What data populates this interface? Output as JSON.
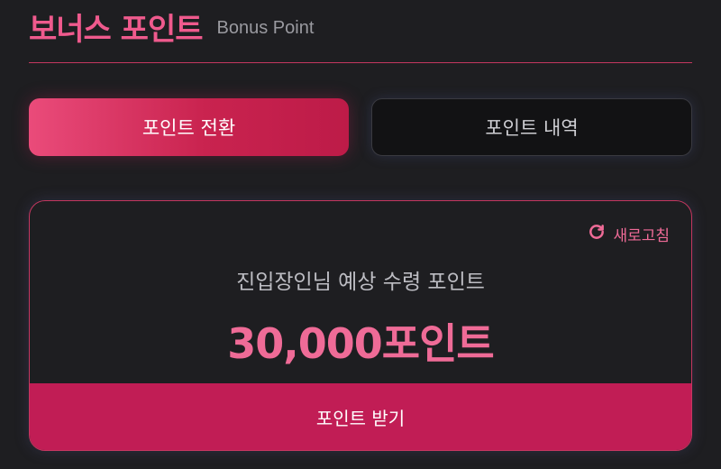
{
  "header": {
    "title": "보너스 포인트",
    "subtitle": "Bonus Point"
  },
  "tabs": [
    {
      "label": "포인트 전환",
      "active": true
    },
    {
      "label": "포인트 내역",
      "active": false
    }
  ],
  "card": {
    "refresh_label": "새로고침",
    "label": "진입장인님 예상 수령 포인트",
    "points": "30,000포인트",
    "button_label": "포인트 받기"
  },
  "colors": {
    "accent": "#ef5a8d",
    "button": "#c11d55",
    "background": "#1e1e21"
  }
}
